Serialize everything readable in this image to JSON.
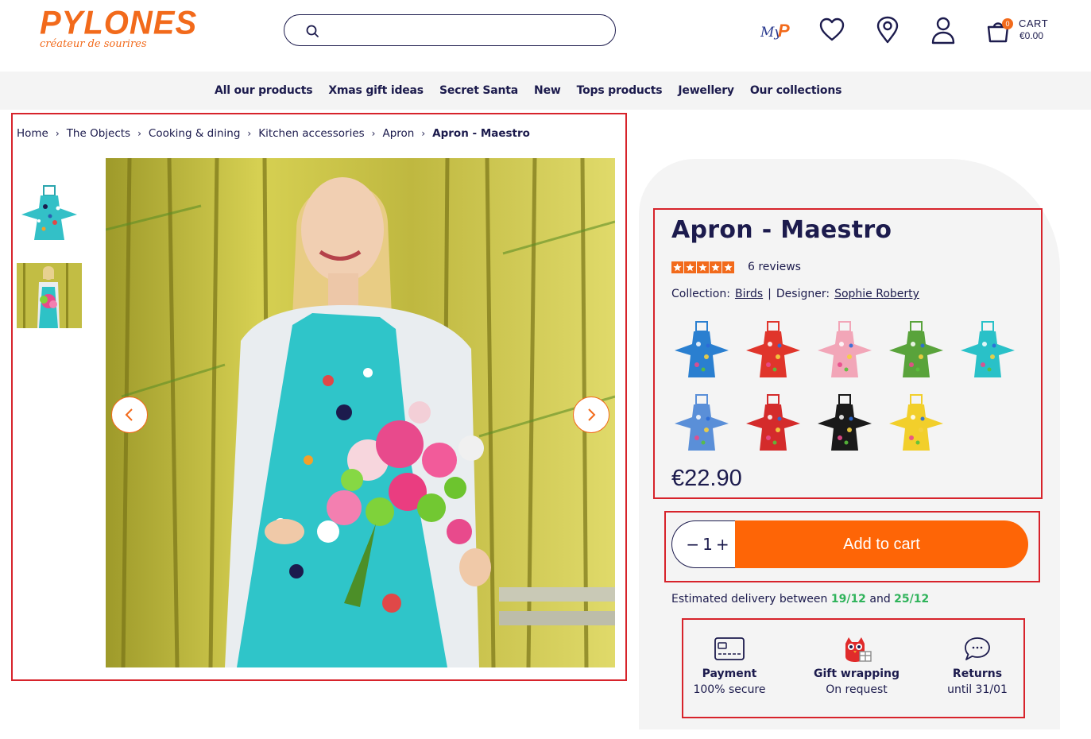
{
  "brand": {
    "name": "PYLONES",
    "tagline": "créateur de sourires",
    "accent": "#f26a1b"
  },
  "header": {
    "search_placeholder": "",
    "icons": [
      "myp-icon",
      "heart-icon",
      "location-pin-icon",
      "user-icon",
      "cart-icon"
    ],
    "myp_label": "MyP",
    "cart_count": "0",
    "cart_label": "CART",
    "cart_total": "€0.00"
  },
  "nav": {
    "items": [
      {
        "label": "All our products"
      },
      {
        "label": "Xmas gift ideas"
      },
      {
        "label": "Secret Santa"
      },
      {
        "label": "New"
      },
      {
        "label": "Tops products"
      },
      {
        "label": "Jewellery"
      },
      {
        "label": "Our collections"
      }
    ]
  },
  "breadcrumb": {
    "items": [
      {
        "label": "Home"
      },
      {
        "label": "The Objects"
      },
      {
        "label": "Cooking & dining"
      },
      {
        "label": "Kitchen accessories"
      },
      {
        "label": "Apron"
      }
    ],
    "current": "Apron - Maestro"
  },
  "product": {
    "title": "Apron - Maestro",
    "rating": 5,
    "reviews": "6 reviews",
    "collection_label": "Collection:",
    "collection": "Birds",
    "designer_label": "Designer:",
    "designer": "Sophie Roberty",
    "price": "€22.90",
    "quantity": "1",
    "add_to_cart": "Add to cart",
    "variant_colors": [
      "#2a7fd0",
      "#e0352b",
      "#f2a6b8",
      "#59a33b",
      "#29c1c8",
      "#5a8fd8",
      "#d42b2b",
      "#1a1a1a",
      "#f2cf2b"
    ]
  },
  "delivery": {
    "prefix": "Estimated delivery between",
    "from": "19/12",
    "and": "and",
    "to": "25/12"
  },
  "features": [
    {
      "title": "Payment",
      "sub": "100% secure",
      "icon": "credit-card-icon"
    },
    {
      "title": "Gift wrapping",
      "sub": "On request",
      "icon": "gift-owl-icon"
    },
    {
      "title": "Returns",
      "sub": "until 31/01",
      "icon": "chat-bubble-icon"
    }
  ],
  "colors": {
    "navy": "#1c1b4d",
    "orange": "#fe6506",
    "green": "#2fb35a",
    "highlight": "#d7232b"
  }
}
